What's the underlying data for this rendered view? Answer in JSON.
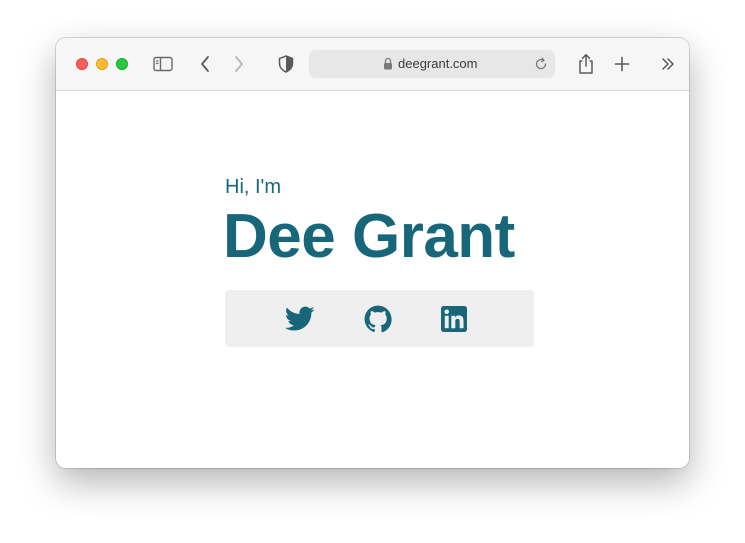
{
  "browser": {
    "url": "deegrant.com"
  },
  "page": {
    "greeting": "Hi, I'm",
    "name": "Dee Grant",
    "social_links": [
      {
        "name": "twitter",
        "icon": "twitter-icon"
      },
      {
        "name": "github",
        "icon": "github-icon"
      },
      {
        "name": "linkedin",
        "icon": "linkedin-icon"
      }
    ]
  },
  "colors": {
    "accent": "#17667a",
    "social_bar_bg": "#efefef",
    "toolbar_bg": "#f6f6f6",
    "address_bg": "#e7e7e7"
  }
}
